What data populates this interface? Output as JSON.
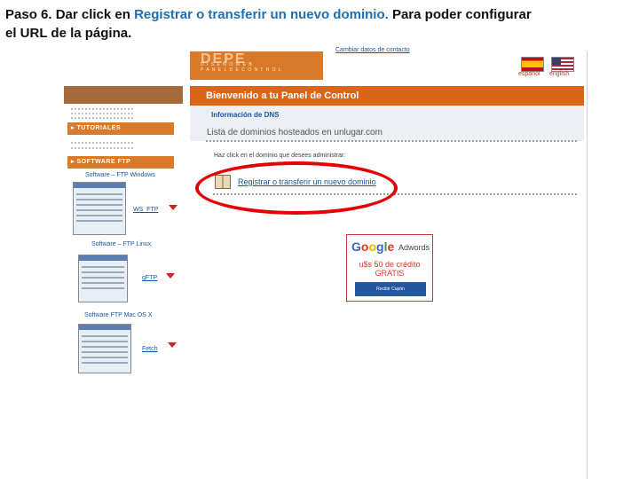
{
  "caption": {
    "prefix": "Paso 6. Dar click en ",
    "highlight": "Registrar o transferir un nuevo dominio.",
    "suffix": " Para poder configurar el URL de la página."
  },
  "header": {
    "logo_text": "DEPE",
    "logo_sub_1": "D I S E Ñ O  W E B",
    "logo_sub_2": "P A N E L  D E  C O N T R O L",
    "top_link": "Cambiar datos de contacto",
    "languages": [
      "español",
      "english"
    ]
  },
  "sidebar": {
    "sections": [
      {
        "label": "▸ TUTORIALES"
      },
      {
        "label": "▸ SOFTWARE FTP"
      }
    ],
    "software": [
      {
        "title": "Software – FTP Windows",
        "link": "WS_FTP"
      },
      {
        "title": "Software – FTP Linux",
        "link": "gFTP"
      },
      {
        "title": "Software FTP Mac OS X",
        "link": "Fetch"
      }
    ]
  },
  "main": {
    "welcome": "Bienvenido a tu Panel de Control",
    "info_link": "Información de DNS",
    "list_title": "Lista de dominios hosteados en unlugar.com",
    "hint": "Haz click en el dominio que desees administrar:",
    "register_link": "Registrar o transferir un nuevo dominio"
  },
  "ad": {
    "brand_letters": [
      "G",
      "o",
      "o",
      "g",
      "l",
      "e"
    ],
    "product": "Adwords",
    "line1": "u$s 50 de crédito",
    "line2": "GRATIS",
    "button": "Recibir Cupón"
  },
  "colors": {
    "accent_orange": "#d8651a",
    "link_blue": "#1a55a0",
    "annotation_red": "#e60000"
  }
}
